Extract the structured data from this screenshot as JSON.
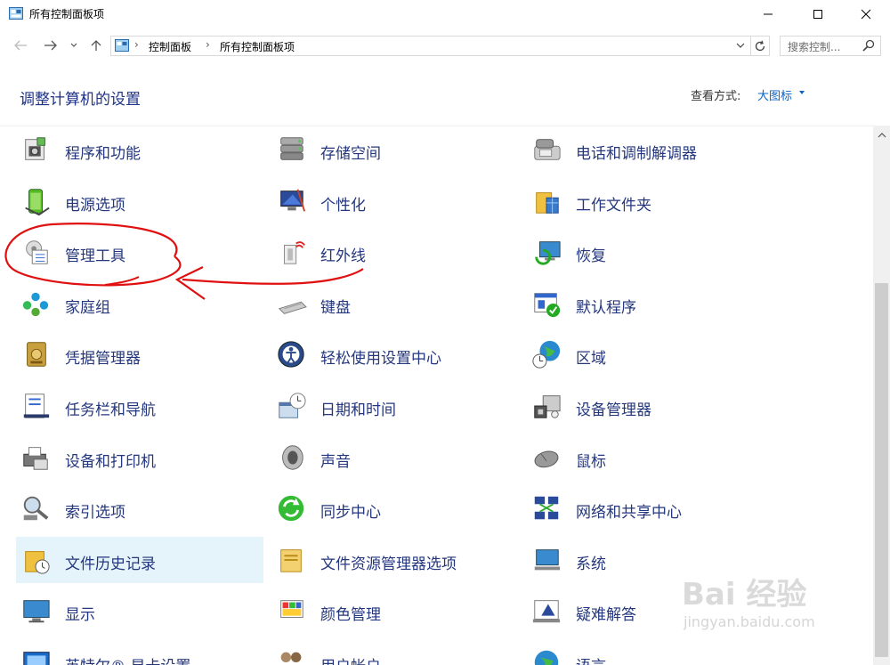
{
  "window": {
    "title": "所有控制面板项",
    "minimize_icon": "minimize-icon",
    "maximize_icon": "maximize-icon",
    "close_icon": "close-icon"
  },
  "address_bar": {
    "breadcrumbs": [
      "控制面板",
      "所有控制面板项"
    ],
    "search_placeholder": "搜索控制..."
  },
  "header": {
    "title": "调整计算机的设置",
    "view_by_label": "查看方式:",
    "view_by_value": "大图标"
  },
  "items": [
    {
      "label": "程序和功能",
      "icon": "programs-icon",
      "col": 0,
      "row": 0
    },
    {
      "label": "存储空间",
      "icon": "storage-spaces-icon",
      "col": 1,
      "row": 0
    },
    {
      "label": "电话和调制解调器",
      "icon": "phone-modem-icon",
      "col": 2,
      "row": 0
    },
    {
      "label": "电源选项",
      "icon": "power-options-icon",
      "col": 0,
      "row": 1
    },
    {
      "label": "个性化",
      "icon": "personalization-icon",
      "col": 1,
      "row": 1
    },
    {
      "label": "工作文件夹",
      "icon": "work-folders-icon",
      "col": 2,
      "row": 1
    },
    {
      "label": "管理工具",
      "icon": "admin-tools-icon",
      "col": 0,
      "row": 2
    },
    {
      "label": "红外线",
      "icon": "infrared-icon",
      "col": 1,
      "row": 2
    },
    {
      "label": "恢复",
      "icon": "recovery-icon",
      "col": 2,
      "row": 2
    },
    {
      "label": "家庭组",
      "icon": "homegroup-icon",
      "col": 0,
      "row": 3
    },
    {
      "label": "键盘",
      "icon": "keyboard-icon",
      "col": 1,
      "row": 3
    },
    {
      "label": "默认程序",
      "icon": "default-programs-icon",
      "col": 2,
      "row": 3
    },
    {
      "label": "凭据管理器",
      "icon": "credential-manager-icon",
      "col": 0,
      "row": 4
    },
    {
      "label": "轻松使用设置中心",
      "icon": "ease-of-access-icon",
      "col": 1,
      "row": 4
    },
    {
      "label": "区域",
      "icon": "region-icon",
      "col": 2,
      "row": 4
    },
    {
      "label": "任务栏和导航",
      "icon": "taskbar-icon",
      "col": 0,
      "row": 5
    },
    {
      "label": "日期和时间",
      "icon": "date-time-icon",
      "col": 1,
      "row": 5
    },
    {
      "label": "设备管理器",
      "icon": "device-manager-icon",
      "col": 2,
      "row": 5
    },
    {
      "label": "设备和打印机",
      "icon": "devices-printers-icon",
      "col": 0,
      "row": 6
    },
    {
      "label": "声音",
      "icon": "sound-icon",
      "col": 1,
      "row": 6
    },
    {
      "label": "鼠标",
      "icon": "mouse-icon",
      "col": 2,
      "row": 6
    },
    {
      "label": "索引选项",
      "icon": "indexing-icon",
      "col": 0,
      "row": 7
    },
    {
      "label": "同步中心",
      "icon": "sync-center-icon",
      "col": 1,
      "row": 7
    },
    {
      "label": "网络和共享中心",
      "icon": "network-sharing-icon",
      "col": 2,
      "row": 7
    },
    {
      "label": "文件历史记录",
      "icon": "file-history-icon",
      "col": 0,
      "row": 8,
      "selected": true
    },
    {
      "label": "文件资源管理器选项",
      "icon": "explorer-options-icon",
      "col": 1,
      "row": 8
    },
    {
      "label": "系统",
      "icon": "system-icon",
      "col": 2,
      "row": 8
    },
    {
      "label": "显示",
      "icon": "display-icon",
      "col": 0,
      "row": 9
    },
    {
      "label": "颜色管理",
      "icon": "color-management-icon",
      "col": 1,
      "row": 9
    },
    {
      "label": "疑难解答",
      "icon": "troubleshooting-icon",
      "col": 2,
      "row": 9
    },
    {
      "label": "英特尔® 显卡设置",
      "icon": "intel-graphics-icon",
      "col": 0,
      "row": 10
    },
    {
      "label": "用户帐户",
      "icon": "user-accounts-icon",
      "col": 1,
      "row": 10
    },
    {
      "label": "语言",
      "icon": "language-icon",
      "col": 2,
      "row": 10
    }
  ],
  "colors": {
    "heading": "#1e3287",
    "item_text": "#24377e",
    "link": "#0a64c8",
    "selection": "#e5f3fb",
    "annotation": "#e01010"
  },
  "watermark": {
    "main": "Bai  经验",
    "sub": "jingyan.baidu.com"
  }
}
